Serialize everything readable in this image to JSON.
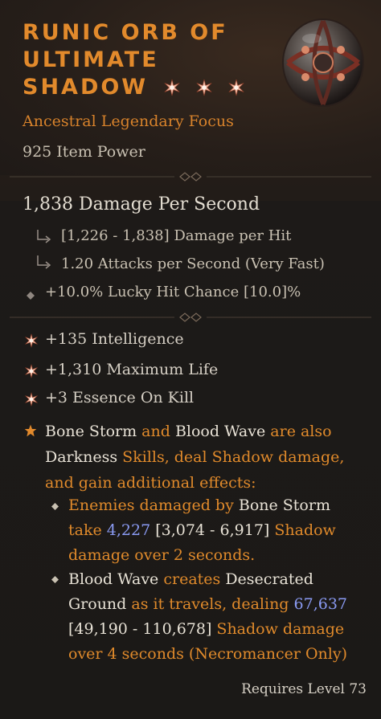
{
  "item": {
    "name_line1": "RUNIC ORB OF",
    "name_line2": "ULTIMATE",
    "name_line3": "SHADOW",
    "greater_affix_count": 3,
    "subtype": "Ancestral Legendary Focus",
    "item_power": "925 Item Power",
    "icon": "orb-item-icon",
    "colors": {
      "legendary_orange": "#e28a2c",
      "value_blue": "#8a9af2",
      "text_light": "#e8e2d6"
    }
  },
  "stats": {
    "dps": "1,838 Damage Per Second",
    "damage_per_hit": "[1,226 - 1,838] Damage per Hit",
    "attack_speed": "1.20 Attacks per Second (Very Fast)",
    "lucky_hit": "+10.0% Lucky Hit Chance [10.0]%"
  },
  "affixes": [
    "+135 Intelligence",
    "+1,310 Maximum Life",
    "+3 Essence On Kill"
  ],
  "aspect": {
    "s1": "Bone Storm",
    "s2": " and ",
    "s3": "Blood Wave",
    "s4": " are also",
    "s5": "Darkness",
    "s6": " Skills, deal Shadow damage,",
    "s7": "and gain additional effects:",
    "b1": {
      "t1": "Enemies damaged by ",
      "t2": "Bone Storm",
      "t3": "take ",
      "t4": "4,227",
      "t5": " [3,074 - 6,917]",
      "t6": " Shadow",
      "t7": "damage over 2 seconds."
    },
    "b2": {
      "t1": "Blood Wave",
      "t2": " creates ",
      "t3": "Desecrated",
      "t4": "Ground",
      "t5": " as it travels, dealing ",
      "t6": "67,637",
      "t7": "[49,190 - 110,678]",
      "t8": " Shadow damage",
      "t9": "over 4 seconds (Necromancer Only)"
    }
  },
  "requirement": "Requires Level 73"
}
